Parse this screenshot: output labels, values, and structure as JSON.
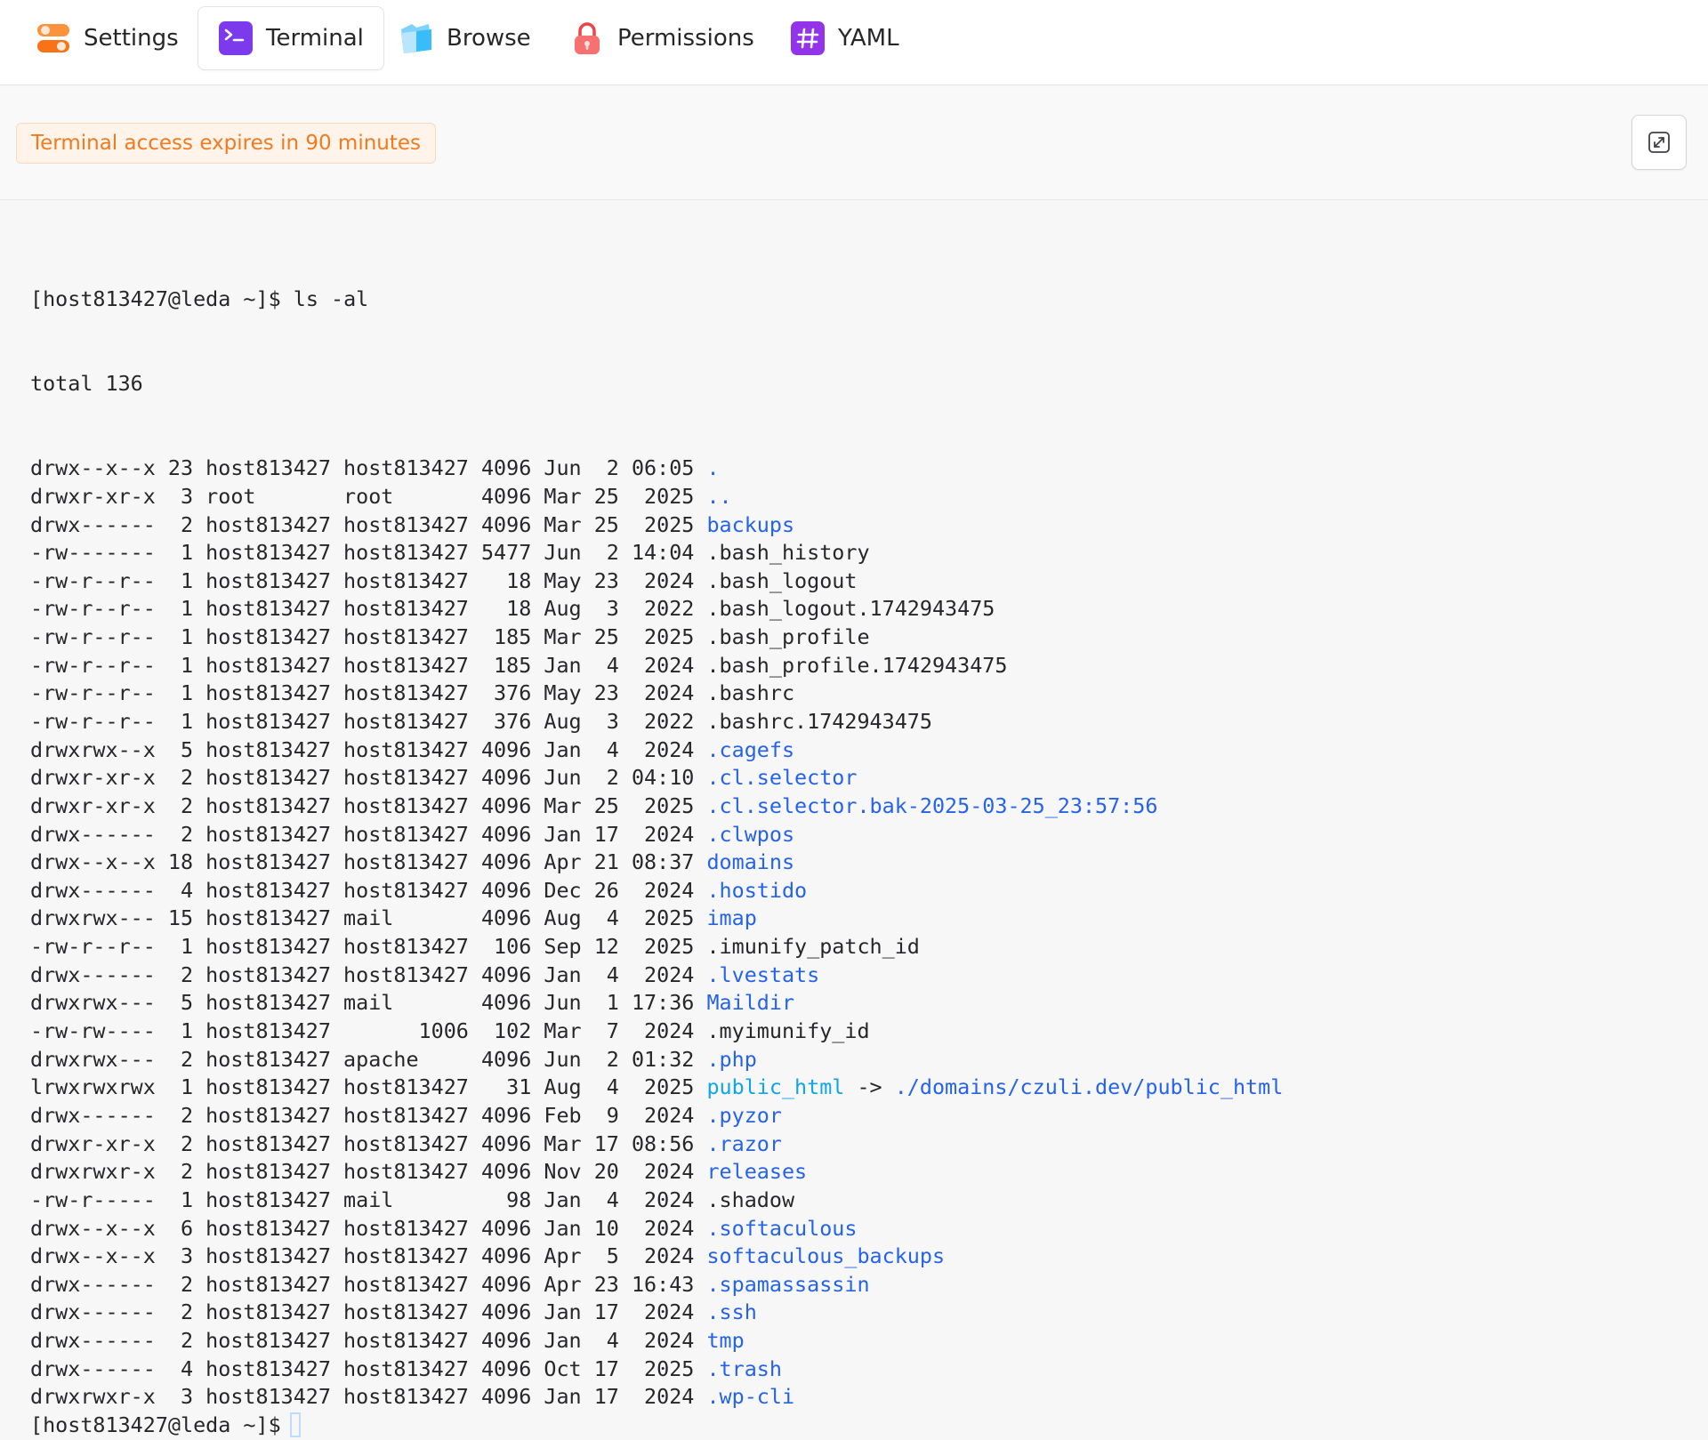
{
  "tabs": [
    {
      "id": "settings",
      "label": "Settings",
      "icon": "toggle-switch-icon",
      "active": false
    },
    {
      "id": "terminal",
      "label": "Terminal",
      "icon": "terminal-prompt-icon",
      "active": true
    },
    {
      "id": "browse",
      "label": "Browse",
      "icon": "folder-icon",
      "active": false
    },
    {
      "id": "permissions",
      "label": "Permissions",
      "icon": "padlock-icon",
      "active": false
    },
    {
      "id": "yaml",
      "label": "YAML",
      "icon": "hashtag-icon",
      "active": false
    }
  ],
  "info": {
    "expiry_notice": "Terminal access expires in 90 minutes",
    "expand_icon": "expand-arrows-icon"
  },
  "colors": {
    "directory": "#2563eb",
    "symlink": "#0ea5e9",
    "text": "#27272a",
    "warning_text": "#f07a1e",
    "warning_bg": "#fff3ea"
  },
  "terminal": {
    "prompt": "[host813427@leda ~]$",
    "command": "ls -al",
    "total_line": "total 136",
    "entries": [
      {
        "meta": "drwx--x--x 23 host813427 host813427 4096 Jun  2 06:05",
        "name": ".",
        "type": "dir"
      },
      {
        "meta": "drwxr-xr-x  3 root       root       4096 Mar 25  2025",
        "name": "..",
        "type": "dir"
      },
      {
        "meta": "drwx------  2 host813427 host813427 4096 Mar 25  2025",
        "name": "backups",
        "type": "dir"
      },
      {
        "meta": "-rw-------  1 host813427 host813427 5477 Jun  2 14:04",
        "name": ".bash_history",
        "type": "file"
      },
      {
        "meta": "-rw-r--r--  1 host813427 host813427   18 May 23  2024",
        "name": ".bash_logout",
        "type": "file"
      },
      {
        "meta": "-rw-r--r--  1 host813427 host813427   18 Aug  3  2022",
        "name": ".bash_logout.1742943475",
        "type": "file"
      },
      {
        "meta": "-rw-r--r--  1 host813427 host813427  185 Mar 25  2025",
        "name": ".bash_profile",
        "type": "file"
      },
      {
        "meta": "-rw-r--r--  1 host813427 host813427  185 Jan  4  2024",
        "name": ".bash_profile.1742943475",
        "type": "file"
      },
      {
        "meta": "-rw-r--r--  1 host813427 host813427  376 May 23  2024",
        "name": ".bashrc",
        "type": "file"
      },
      {
        "meta": "-rw-r--r--  1 host813427 host813427  376 Aug  3  2022",
        "name": ".bashrc.1742943475",
        "type": "file"
      },
      {
        "meta": "drwxrwx--x  5 host813427 host813427 4096 Jan  4  2024",
        "name": ".cagefs",
        "type": "dir"
      },
      {
        "meta": "drwxr-xr-x  2 host813427 host813427 4096 Jun  2 04:10",
        "name": ".cl.selector",
        "type": "dir"
      },
      {
        "meta": "drwxr-xr-x  2 host813427 host813427 4096 Mar 25  2025",
        "name": ".cl.selector.bak-2025-03-25_23:57:56",
        "type": "dir"
      },
      {
        "meta": "drwx------  2 host813427 host813427 4096 Jan 17  2024",
        "name": ".clwpos",
        "type": "dir"
      },
      {
        "meta": "drwx--x--x 18 host813427 host813427 4096 Apr 21 08:37",
        "name": "domains",
        "type": "dir"
      },
      {
        "meta": "drwx------  4 host813427 host813427 4096 Dec 26  2024",
        "name": ".hostido",
        "type": "dir"
      },
      {
        "meta": "drwxrwx--- 15 host813427 mail       4096 Aug  4  2025",
        "name": "imap",
        "type": "dir"
      },
      {
        "meta": "-rw-r--r--  1 host813427 host813427  106 Sep 12  2025",
        "name": ".imunify_patch_id",
        "type": "file"
      },
      {
        "meta": "drwx------  2 host813427 host813427 4096 Jan  4  2024",
        "name": ".lvestats",
        "type": "dir"
      },
      {
        "meta": "drwxrwx---  5 host813427 mail       4096 Jun  1 17:36",
        "name": "Maildir",
        "type": "dir"
      },
      {
        "meta": "-rw-rw----  1 host813427       1006  102 Mar  7  2024",
        "name": ".myimunify_id",
        "type": "file"
      },
      {
        "meta": "drwxrwx---  2 host813427 apache     4096 Jun  2 01:32",
        "name": ".php",
        "type": "dir"
      },
      {
        "meta": "lrwxrwxrwx  1 host813427 host813427   31 Aug  4  2025",
        "name": "public_html",
        "type": "link",
        "arrow": " -> ",
        "target": "./domains/czuli.dev/public_html"
      },
      {
        "meta": "drwx------  2 host813427 host813427 4096 Feb  9  2024",
        "name": ".pyzor",
        "type": "dir"
      },
      {
        "meta": "drwxr-xr-x  2 host813427 host813427 4096 Mar 17 08:56",
        "name": ".razor",
        "type": "dir"
      },
      {
        "meta": "drwxrwxr-x  2 host813427 host813427 4096 Nov 20  2024",
        "name": "releases",
        "type": "dir"
      },
      {
        "meta": "-rw-r-----  1 host813427 mail         98 Jan  4  2024",
        "name": ".shadow",
        "type": "file"
      },
      {
        "meta": "drwx--x--x  6 host813427 host813427 4096 Jan 10  2024",
        "name": ".softaculous",
        "type": "dir"
      },
      {
        "meta": "drwx--x--x  3 host813427 host813427 4096 Apr  5  2024",
        "name": "softaculous_backups",
        "type": "dir"
      },
      {
        "meta": "drwx------  2 host813427 host813427 4096 Apr 23 16:43",
        "name": ".spamassassin",
        "type": "dir"
      },
      {
        "meta": "drwx------  2 host813427 host813427 4096 Jan 17  2024",
        "name": ".ssh",
        "type": "dir"
      },
      {
        "meta": "drwx------  2 host813427 host813427 4096 Jan  4  2024",
        "name": "tmp",
        "type": "dir"
      },
      {
        "meta": "drwx------  4 host813427 host813427 4096 Oct 17  2025",
        "name": ".trash",
        "type": "dir"
      },
      {
        "meta": "drwxrwxr-x  3 host813427 host813427 4096 Jan 17  2024",
        "name": ".wp-cli",
        "type": "dir"
      }
    ]
  }
}
